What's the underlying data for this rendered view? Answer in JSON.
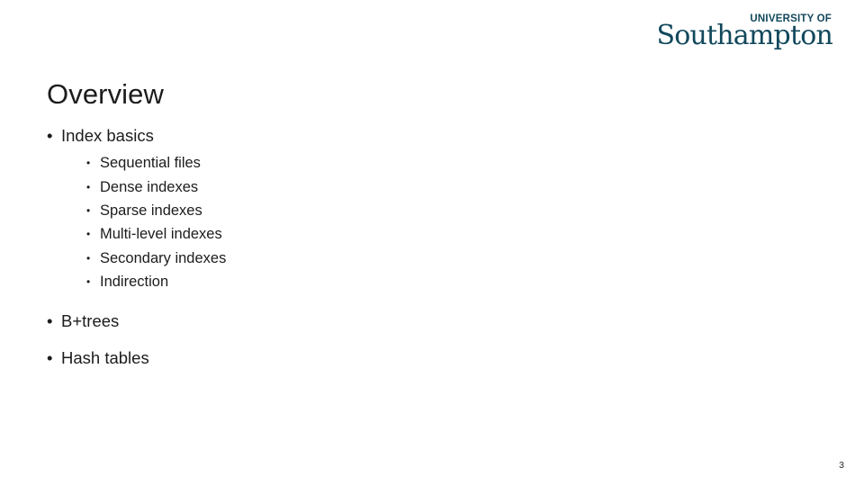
{
  "slide": {
    "title": "Overview",
    "page_number": "3",
    "background_color": "#ffffff",
    "text_color": "#1c1c1c"
  },
  "logo": {
    "sub_text": "UNIVERSITY OF",
    "main_text": "Southampton",
    "color": "#12485c"
  },
  "bullets": {
    "marker_level1": "•",
    "marker_level2": "•",
    "items": [
      {
        "label": "Index basics",
        "children": [
          "Sequential files",
          "Dense indexes",
          "Sparse indexes",
          "Multi-level indexes",
          "Secondary indexes",
          "Indirection"
        ]
      },
      {
        "label": "B+trees",
        "children": []
      },
      {
        "label": "Hash tables",
        "children": []
      }
    ]
  }
}
